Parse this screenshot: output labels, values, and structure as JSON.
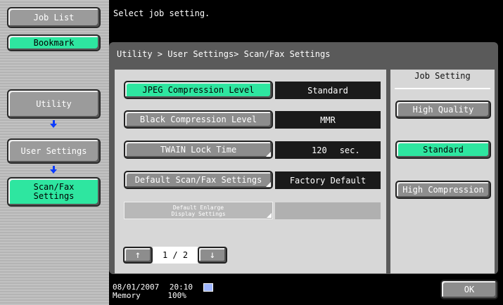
{
  "sidebar": {
    "job_list": "Job List",
    "bookmark": "Bookmark",
    "utility": "Utility",
    "user_settings": "User Settings",
    "scan_fax_line1": "Scan/Fax",
    "scan_fax_line2": "Settings"
  },
  "message": "Select job setting.",
  "breadcrumb": "Utility > User Settings> Scan/Fax Settings",
  "settings": [
    {
      "label": "JPEG Compression Level",
      "value": "Standard"
    },
    {
      "label": "Black Compression Level",
      "value": "MMR"
    },
    {
      "label": "TWAIN Lock Time",
      "value": "120",
      "unit": "sec."
    },
    {
      "label": "Default Scan/Fax Settings",
      "value": "Factory Default"
    },
    {
      "label_line1": "Default Enlarge",
      "label_line2": "Display Settings",
      "value": ""
    }
  ],
  "pager": {
    "page": "1 / 2"
  },
  "job_setting": {
    "title": "Job Setting",
    "options": [
      "High Quality",
      "Standard",
      "High Compression"
    ],
    "selected": "Standard"
  },
  "status": {
    "date": "08/01/2007",
    "time": "20:10",
    "memory_label": "Memory",
    "memory_value": "100%"
  },
  "ok_label": "OK",
  "colors": {
    "selected": "#2ee6a0",
    "button": "#8d8d8d",
    "arrow": "#0a3bff"
  }
}
